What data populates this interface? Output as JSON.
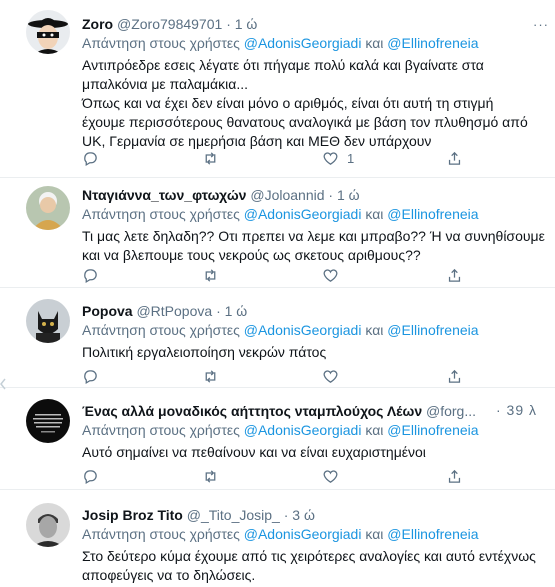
{
  "reply_prefix": "Απάντηση στους χρήστες",
  "mention1": "@AdonisGeorgiadi",
  "and": "και",
  "mention2": "@Ellinofreneia",
  "dot": "·",
  "more": "···",
  "tweets": [
    {
      "name": "Zoro",
      "handle": "@Zoro79849701",
      "time": "1 ώ",
      "text": "Αντιπρόεδρε εσεις λέγατε  ότι πήγαμε πολύ καλά και βγαίνατε στα\nμπαλκόνια με παλαμάκια...\nΌπως και να έχει δεν είναι μόνο ο αριθμός, είναι ότι αυτή τη στιγμή\nέχουμε περισσότερους θανατους αναλογικά με βάση τον πλυθησμό  από\nUK, Γερμανία σε ημερήσια βάση και ΜΕΘ  δεν υπάρχουν",
      "like_count": "1"
    },
    {
      "name": "Νταγιάννα_των_φτωχών",
      "handle": "@Joloannid",
      "time": "1 ώ",
      "text": "Τι μας λετε δηλαδη?? Οτι πρεπει να λεμε και μπραβο?? Ή να συνηθίσουμε\nκαι να βλεπουμε τους νεκρούς ως σκετους αριθμους??",
      "like_count": ""
    },
    {
      "name": "Popova",
      "handle": "@RtPopova",
      "time": "1 ώ",
      "text": "Πολιτική εργαλειοποίηση νεκρών πάτος",
      "like_count": ""
    },
    {
      "name": "Ένας αλλά μοναδικός αήττητος νταμπλούχος Λέων",
      "handle": "@forg...",
      "time": "39 λ",
      "text": "Αυτό σημαίνει να πεθαίνουν και να είναι ευχαριστημένοι",
      "like_count": ""
    },
    {
      "name": "Josip Broz Tito",
      "handle": "@_Tito_Josip_",
      "time": "3 ώ",
      "text": "Στο δεύτερο κύμα έχουμε από τις χειρότερες αναλογίες και αυτό εντέχνως\nαποφεύγεις να το δηλώσεις.",
      "like_count": ""
    }
  ]
}
